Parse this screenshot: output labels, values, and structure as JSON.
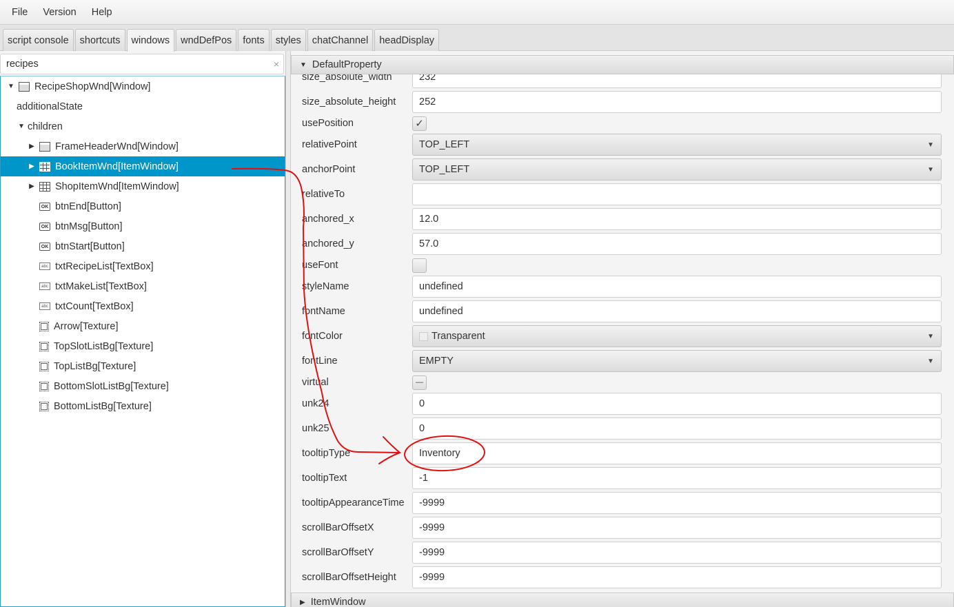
{
  "menu": [
    "File",
    "Version",
    "Help"
  ],
  "tabs": [
    {
      "label": "script console",
      "active": false
    },
    {
      "label": "shortcuts",
      "active": false
    },
    {
      "label": "windows",
      "active": true
    },
    {
      "label": "wndDefPos",
      "active": false
    },
    {
      "label": "fonts",
      "active": false
    },
    {
      "label": "styles",
      "active": false
    },
    {
      "label": "chatChannel",
      "active": false
    },
    {
      "label": "headDisplay",
      "active": false
    }
  ],
  "search": {
    "value": "recipes",
    "clear_icon": "×"
  },
  "tree": [
    {
      "label": "RecipeShopWnd[Window]",
      "depth": 0,
      "expander": "expanded",
      "icon": "window"
    },
    {
      "label": "additionalState",
      "depth": 1,
      "expander": "none",
      "icon": "none"
    },
    {
      "label": "children",
      "depth": 1,
      "expander": "expanded",
      "icon": "none",
      "arrow_only": true
    },
    {
      "label": "FrameHeaderWnd[Window]",
      "depth": 2,
      "expander": "collapsed",
      "icon": "window"
    },
    {
      "label": "BookItemWnd[ItemWindow]",
      "depth": 2,
      "expander": "collapsed",
      "icon": "item",
      "selected": true
    },
    {
      "label": "ShopItemWnd[ItemWindow]",
      "depth": 2,
      "expander": "collapsed",
      "icon": "item"
    },
    {
      "label": "btnEnd[Button]",
      "depth": 2,
      "expander": "none",
      "icon": "button"
    },
    {
      "label": "btnMsg[Button]",
      "depth": 2,
      "expander": "none",
      "icon": "button"
    },
    {
      "label": "btnStart[Button]",
      "depth": 2,
      "expander": "none",
      "icon": "button"
    },
    {
      "label": "txtRecipeList[TextBox]",
      "depth": 2,
      "expander": "none",
      "icon": "textbox"
    },
    {
      "label": "txtMakeList[TextBox]",
      "depth": 2,
      "expander": "none",
      "icon": "textbox"
    },
    {
      "label": "txtCount[TextBox]",
      "depth": 2,
      "expander": "none",
      "icon": "textbox"
    },
    {
      "label": "Arrow[Texture]",
      "depth": 2,
      "expander": "none",
      "icon": "texture"
    },
    {
      "label": "TopSlotListBg[Texture]",
      "depth": 2,
      "expander": "none",
      "icon": "texture"
    },
    {
      "label": "TopListBg[Texture]",
      "depth": 2,
      "expander": "none",
      "icon": "texture"
    },
    {
      "label": "BottomSlotListBg[Texture]",
      "depth": 2,
      "expander": "none",
      "icon": "texture"
    },
    {
      "label": "BottomListBg[Texture]",
      "depth": 2,
      "expander": "none",
      "icon": "texture"
    }
  ],
  "sections": {
    "default": "DefaultProperty",
    "next": "ItemWindow"
  },
  "properties": [
    {
      "name": "size_absolute_width",
      "type": "text",
      "value": "232"
    },
    {
      "name": "size_absolute_height",
      "type": "text",
      "value": "252"
    },
    {
      "name": "usePosition",
      "type": "check",
      "state": "checked"
    },
    {
      "name": "relativePoint",
      "type": "select",
      "value": "TOP_LEFT"
    },
    {
      "name": "anchorPoint",
      "type": "select",
      "value": "TOP_LEFT"
    },
    {
      "name": "relativeTo",
      "type": "text",
      "value": ""
    },
    {
      "name": "anchored_x",
      "type": "text",
      "value": "12.0"
    },
    {
      "name": "anchored_y",
      "type": "text",
      "value": "57.0"
    },
    {
      "name": "useFont",
      "type": "check",
      "state": "unchecked"
    },
    {
      "name": "styleName",
      "type": "text",
      "value": "undefined"
    },
    {
      "name": "fontName",
      "type": "text",
      "value": "undefined"
    },
    {
      "name": "fontColor",
      "type": "select",
      "value": "Transparent",
      "swatch": true
    },
    {
      "name": "fontLine",
      "type": "select",
      "value": "EMPTY"
    },
    {
      "name": "virtual",
      "type": "check",
      "state": "indeterminate"
    },
    {
      "name": "unk24",
      "type": "text",
      "value": "0"
    },
    {
      "name": "unk25",
      "type": "text",
      "value": "0"
    },
    {
      "name": "tooltipType",
      "type": "text",
      "value": "Inventory"
    },
    {
      "name": "tooltipText",
      "type": "text",
      "value": "-1"
    },
    {
      "name": "tooltipAppearanceTime",
      "type": "text",
      "value": "-9999"
    },
    {
      "name": "scrollBarOffsetX",
      "type": "text",
      "value": "-9999"
    },
    {
      "name": "scrollBarOffsetY",
      "type": "text",
      "value": "-9999"
    },
    {
      "name": "scrollBarOffsetHeight",
      "type": "text",
      "value": "-9999"
    }
  ],
  "colors": {
    "selection": "#0096c9",
    "focus_border": "#2a9fc4",
    "annotation": "#e01010"
  }
}
